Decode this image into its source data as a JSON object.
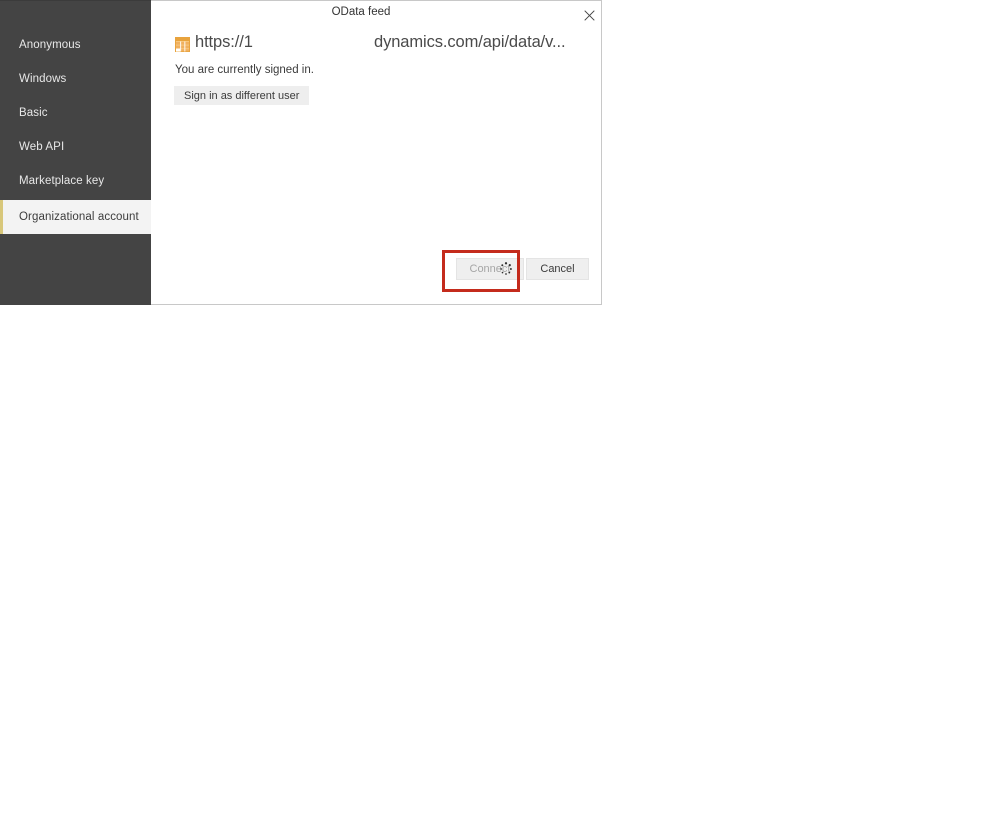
{
  "dialog": {
    "title": "OData feed",
    "close_icon": "close-icon"
  },
  "nav": {
    "items": [
      {
        "label": "Anonymous",
        "selected": false
      },
      {
        "label": "Windows",
        "selected": false
      },
      {
        "label": "Basic",
        "selected": false
      },
      {
        "label": "Web API",
        "selected": false
      },
      {
        "label": "Marketplace key",
        "selected": false
      },
      {
        "label": "Organizational account",
        "selected": true
      }
    ]
  },
  "body": {
    "feed_icon": "table-feed-icon",
    "url_left": "https://1",
    "url_right": "dynamics.com/api/data/v...",
    "status": "You are currently signed in.",
    "signin_different_user": "Sign in as different user"
  },
  "footer": {
    "connect_label": "Connect",
    "connect_disabled": true,
    "cancel_label": "Cancel",
    "busy_cursor_icon": "busy-spinner-cursor"
  },
  "annotation": {
    "highlight_color": "#c42b1c",
    "highlight_target": "connect-button"
  },
  "colors": {
    "nav_background": "#444444",
    "nav_selected_background": "#f3f3f3",
    "nav_accent": "#d8c77a",
    "dialog_background": "#ffffff",
    "button_background": "#efefef",
    "feed_icon_color": "#e8a33d",
    "highlight": "#c42b1c"
  }
}
